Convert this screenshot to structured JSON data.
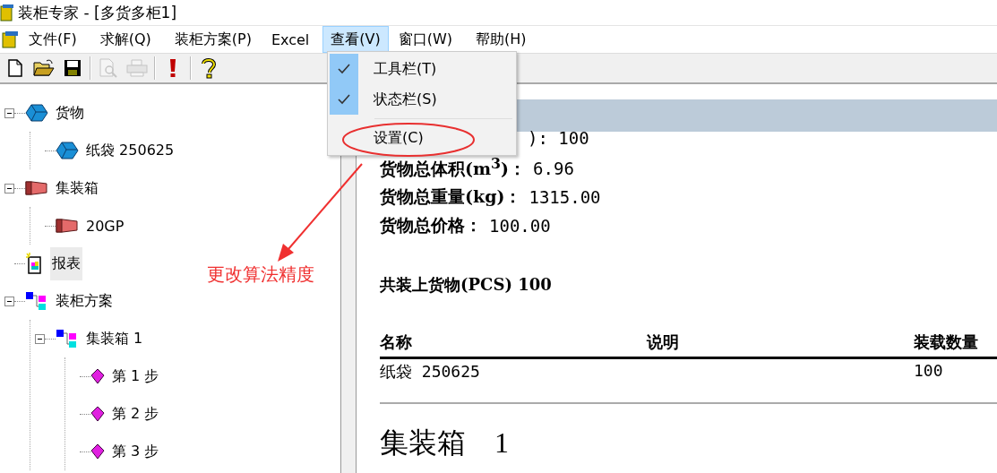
{
  "window": {
    "title": "装柜专家 - [多货多柜1]"
  },
  "menu_bar": [
    {
      "label": "文件(F)",
      "selected": false
    },
    {
      "label": "求解(Q)",
      "selected": false
    },
    {
      "label": "装柜方案(P)",
      "selected": false
    },
    {
      "label": "Excel",
      "selected": false
    },
    {
      "label": "查看(V)",
      "selected": true
    },
    {
      "label": "窗口(W)",
      "selected": false
    },
    {
      "label": "帮助(H)",
      "selected": false
    }
  ],
  "toolbar": [
    {
      "kind": "new",
      "disabled": false
    },
    {
      "kind": "open",
      "disabled": false
    },
    {
      "kind": "save",
      "disabled": false
    },
    {
      "kind": "separator"
    },
    {
      "kind": "preview",
      "disabled": true
    },
    {
      "kind": "print",
      "disabled": true
    },
    {
      "kind": "separator"
    },
    {
      "kind": "solve",
      "disabled": false
    },
    {
      "kind": "separator"
    },
    {
      "kind": "help",
      "disabled": false
    }
  ],
  "dropdown_menu": [
    {
      "kind": "item",
      "label": "工具栏(T)",
      "checked": true
    },
    {
      "kind": "item",
      "label": "状态栏(S)",
      "checked": true
    },
    {
      "kind": "separator"
    },
    {
      "kind": "item",
      "label": "设置(C)",
      "checked": false
    }
  ],
  "tree": [
    {
      "kind": "cargo",
      "label": "货物",
      "expanded": true,
      "selected": false,
      "children": [
        {
          "kind": "cargo",
          "label": "纸袋 250625",
          "selected": false
        }
      ]
    },
    {
      "kind": "container",
      "label": "集装箱",
      "expanded": true,
      "selected": false,
      "children": [
        {
          "kind": "container",
          "label": "20GP",
          "selected": false
        }
      ]
    },
    {
      "kind": "report",
      "label": "报表",
      "selected": true
    },
    {
      "kind": "plan",
      "label": "装柜方案",
      "expanded": true,
      "selected": false,
      "children": [
        {
          "kind": "plan",
          "label": "集装箱 1",
          "expanded": true,
          "selected": false,
          "children": [
            {
              "kind": "step",
              "label": "第 1 步",
              "selected": false
            },
            {
              "kind": "step",
              "label": "第 2 步",
              "selected": false
            },
            {
              "kind": "step",
              "label": "第 3 步",
              "selected": false
            }
          ]
        }
      ]
    }
  ],
  "annotation": {
    "label": "更改算法精度"
  },
  "report": {
    "partial_line": "): 100",
    "stats": [
      {
        "label": "货物总体积(m$^{3}$)：",
        "value": "6.96"
      },
      {
        "label": "货物总重量(kg)：",
        "value": "1315.00"
      },
      {
        "label": "货物总价格：",
        "value": "100.00"
      }
    ],
    "total": "共装上货物(PCS) 100",
    "table": {
      "columns": [
        "名称",
        "说明",
        "装载数量"
      ],
      "rows": [
        [
          "纸袋 250625",
          "",
          "100"
        ]
      ]
    },
    "section_title": "集装箱　1"
  }
}
